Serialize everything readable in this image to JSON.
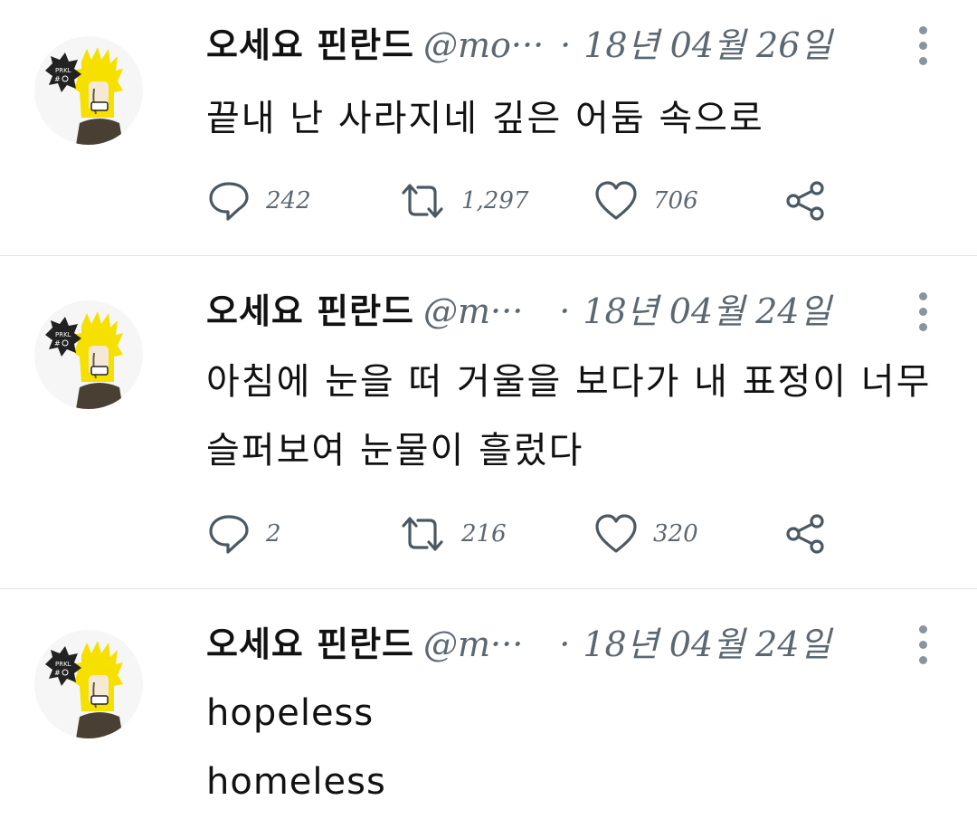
{
  "colors": {
    "divider": "#dfe3e7",
    "meta_text": "#5b6771",
    "icon": "#4a5863",
    "avatar_hair": "#f5e000",
    "avatar_shirt": "#4a3f33"
  },
  "icons": {
    "reply": "speech-bubble-icon",
    "retweet": "retweet-arrows-icon",
    "like": "heart-icon",
    "share": "share-nodes-icon",
    "more": "vertical-dots-icon"
  },
  "tweets": [
    {
      "name": "오세요 핀란드",
      "handle": "@mo···",
      "dot": "·",
      "date": "18년 04월 26일",
      "lines": [
        "끝내 난 사라지네 깊은 어둠 속으로"
      ],
      "replies": "242",
      "retweets": "1,297",
      "likes": "706"
    },
    {
      "name": "오세요 핀란드",
      "handle": "@m···",
      "dot": "·",
      "date": "18년 04월 24일",
      "lines": [
        "아침에 눈을 떠 거울을 보다가 내 표정이 너무",
        "슬퍼보여 눈물이 흘렀다"
      ],
      "replies": "2",
      "retweets": "216",
      "likes": "320"
    },
    {
      "name": "오세요 핀란드",
      "handle": "@m···",
      "dot": "·",
      "date": "18년 04월 24일",
      "lines": [
        "hopeless",
        "homeless"
      ]
    }
  ]
}
